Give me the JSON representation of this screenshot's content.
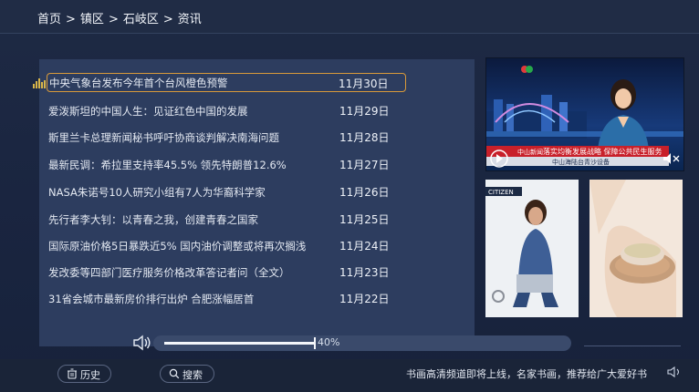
{
  "breadcrumb": {
    "items": [
      "首页",
      "镇区",
      "石岐区",
      "资讯"
    ],
    "separator": ">"
  },
  "news": {
    "items": [
      {
        "title": "中央气象台发布今年首个台风橙色预警",
        "date": "11月30日"
      },
      {
        "title": "爱泼斯坦的中国人生：见证红色中国的发展",
        "date": "11月29日"
      },
      {
        "title": "斯里兰卡总理新闻秘书呼吁协商谈判解决南海问题",
        "date": "11月28日"
      },
      {
        "title": "最新民调：希拉里支持率45.5% 领先特朗普12.6%",
        "date": "11月27日"
      },
      {
        "title": "NASA朱诺号10人研究小组有7人为华裔科学家",
        "date": "11月26日"
      },
      {
        "title": "先行者李大钊：以青春之我，创建青春之国家",
        "date": "11月25日"
      },
      {
        "title": "国际原油价格5日暴跌近5% 国内油价调整或将再次搁浅",
        "date": "11月24日"
      },
      {
        "title": "发改委等四部门医疗服务价格改革答记者问（全文）",
        "date": "11月23日"
      },
      {
        "title": "31省会城市最新房价排行出炉 合肥涨幅居首",
        "date": "11月22日"
      }
    ],
    "selected_index": 0
  },
  "volume": {
    "level": 0.4,
    "label": "40%"
  },
  "video": {
    "station_badge": "中山新闻",
    "ticker_top": "落实均衡发展战略  保障公共民生服务",
    "ticker_bottom": "中山海陆台青沙设备"
  },
  "thumbnails": {
    "magazine_brand": "CITIZEN"
  },
  "bottom_bar": {
    "history_label": "历史",
    "search_label": "搜索",
    "marquee_text": "书画高清频道即将上线，名家书画，推荐给广大爱好书"
  },
  "colors": {
    "selection_border": "#d99a3a",
    "panel_bg": "#2d3d5f",
    "page_bg": "#1e2a44"
  },
  "icons": {
    "list_marker": "equalizer-icon",
    "volume": "speaker-icon",
    "play": "play-icon",
    "history": "history-icon",
    "search": "search-icon",
    "marquee_speaker": "speaker-icon"
  }
}
